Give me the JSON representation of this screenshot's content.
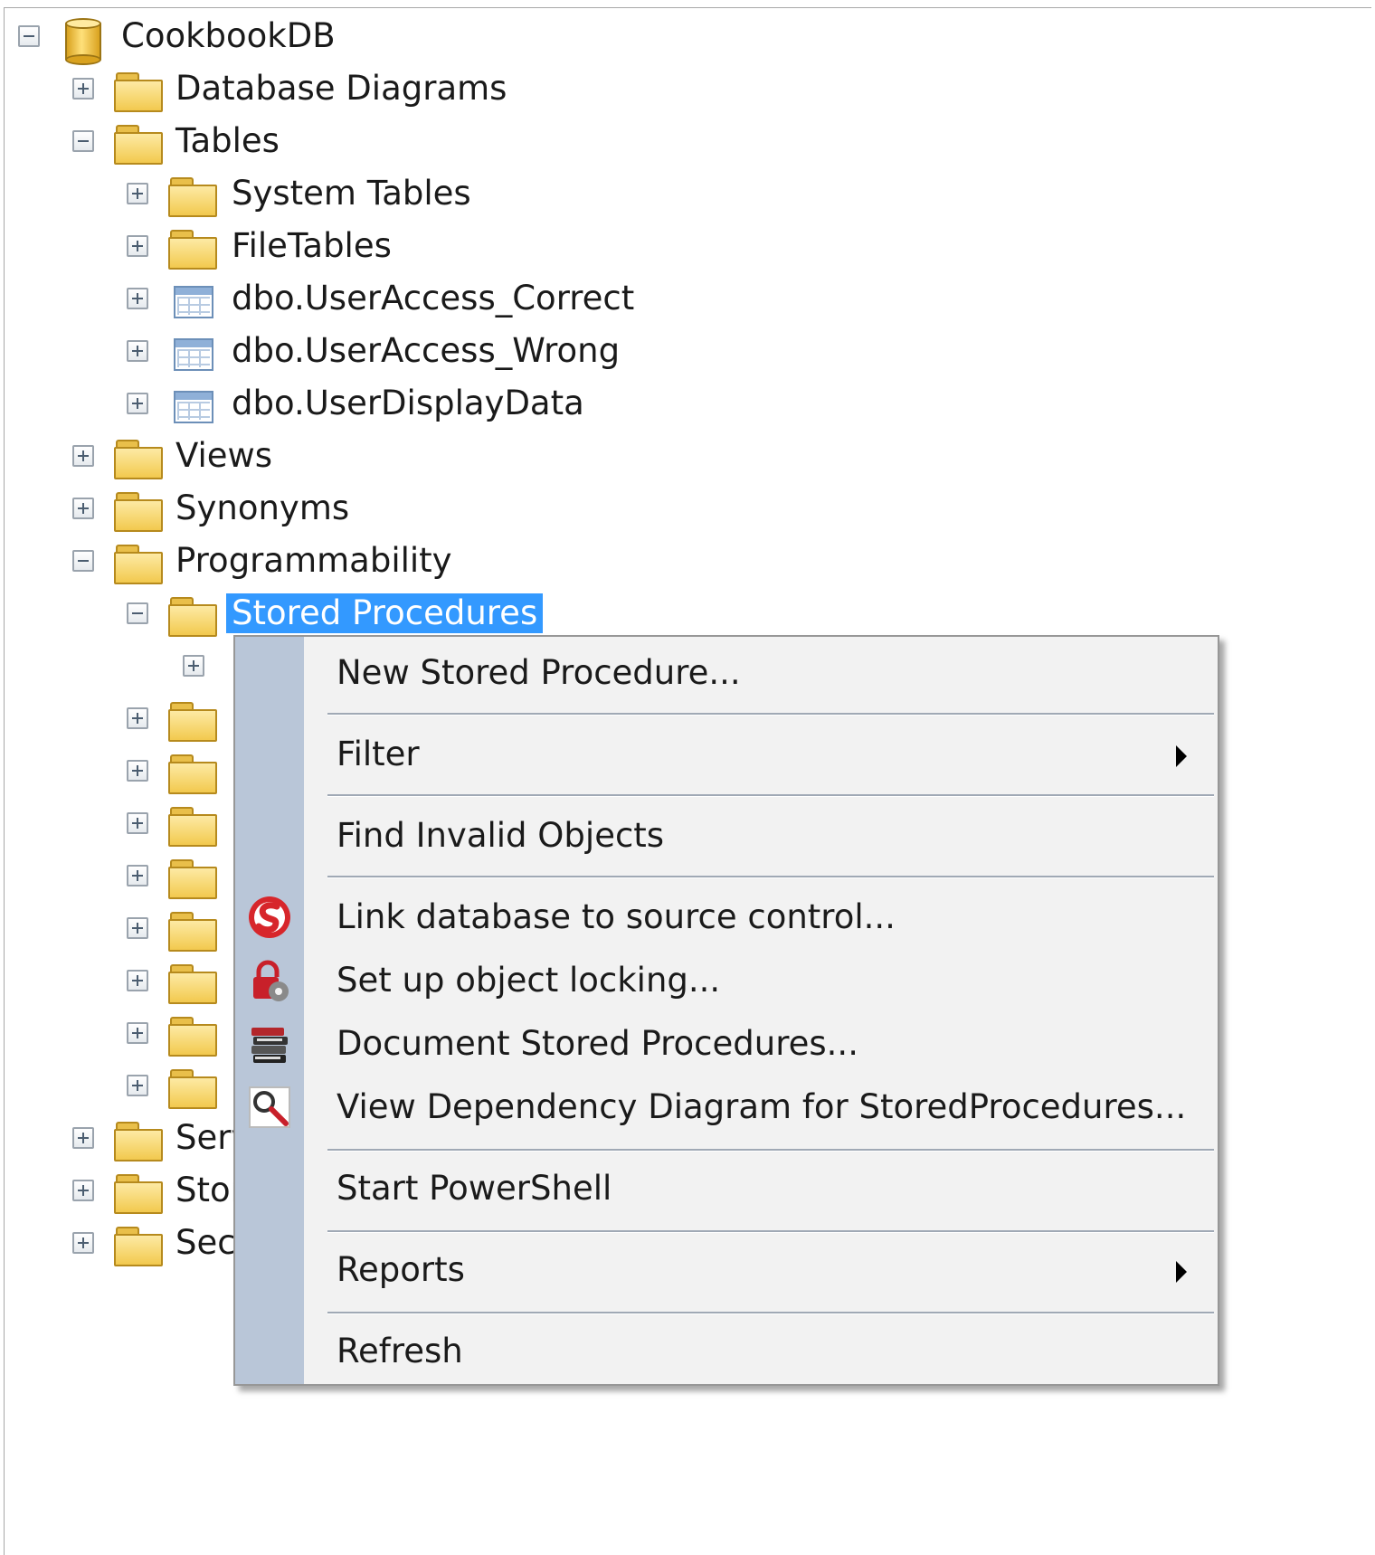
{
  "tree": {
    "root": {
      "label": "CookbookDB",
      "expanded": true
    },
    "nodes": [
      {
        "label": "Database Diagrams",
        "icon": "folder",
        "expanded": false
      },
      {
        "label": "Tables",
        "icon": "folder",
        "expanded": true
      },
      {
        "label": "System Tables",
        "icon": "folder",
        "expanded": false
      },
      {
        "label": "FileTables",
        "icon": "folder",
        "expanded": false
      },
      {
        "label": "dbo.UserAccess_Correct",
        "icon": "table",
        "expanded": false
      },
      {
        "label": "dbo.UserAccess_Wrong",
        "icon": "table",
        "expanded": false
      },
      {
        "label": "dbo.UserDisplayData",
        "icon": "table",
        "expanded": false
      },
      {
        "label": "Views",
        "icon": "folder",
        "expanded": false
      },
      {
        "label": "Synonyms",
        "icon": "folder",
        "expanded": false
      },
      {
        "label": "Programmability",
        "icon": "folder",
        "expanded": true
      },
      {
        "label": "Stored Procedures",
        "icon": "folder",
        "expanded": true,
        "selected": true
      },
      {
        "label": "Serv",
        "icon": "folder",
        "expanded": false
      },
      {
        "label": "Stor",
        "icon": "folder",
        "expanded": false
      },
      {
        "label": "Sec",
        "icon": "folder",
        "expanded": false
      }
    ]
  },
  "context_menu": {
    "items": [
      {
        "label": "New Stored Procedure..."
      },
      {
        "label": "Filter",
        "submenu": true
      },
      {
        "label": "Find Invalid Objects"
      },
      {
        "label": "Link database to source control...",
        "icon": "source-control-icon"
      },
      {
        "label": "Set up object locking...",
        "icon": "object-lock-icon"
      },
      {
        "label": "Document Stored Procedures...",
        "icon": "document-stack-icon"
      },
      {
        "label": "View Dependency Diagram for StoredProcedures...",
        "icon": "dependency-search-icon"
      },
      {
        "label": "Start PowerShell"
      },
      {
        "label": "Reports",
        "submenu": true
      },
      {
        "label": "Refresh"
      }
    ]
  },
  "colors": {
    "selection": "#3399ff",
    "menu_background": "#f2f2f2",
    "menu_gutter": "#b9c6d8",
    "folder": "#f2c94e"
  }
}
